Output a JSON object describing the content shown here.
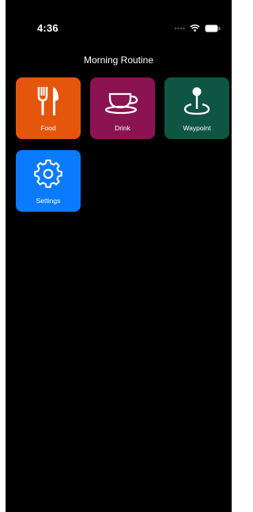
{
  "status": {
    "time": "4:36"
  },
  "page": {
    "title": "Morning Routine"
  },
  "tiles": [
    {
      "label": "Food",
      "icon": "fork-knife-icon",
      "color": "#E4560C"
    },
    {
      "label": "Drink",
      "icon": "cup-saucer-icon",
      "color": "#8B1351"
    },
    {
      "label": "Waypoint",
      "icon": "map-pin-icon",
      "color": "#0F5544"
    },
    {
      "label": "Settings",
      "icon": "gear-icon",
      "color": "#0A7BFF"
    }
  ]
}
